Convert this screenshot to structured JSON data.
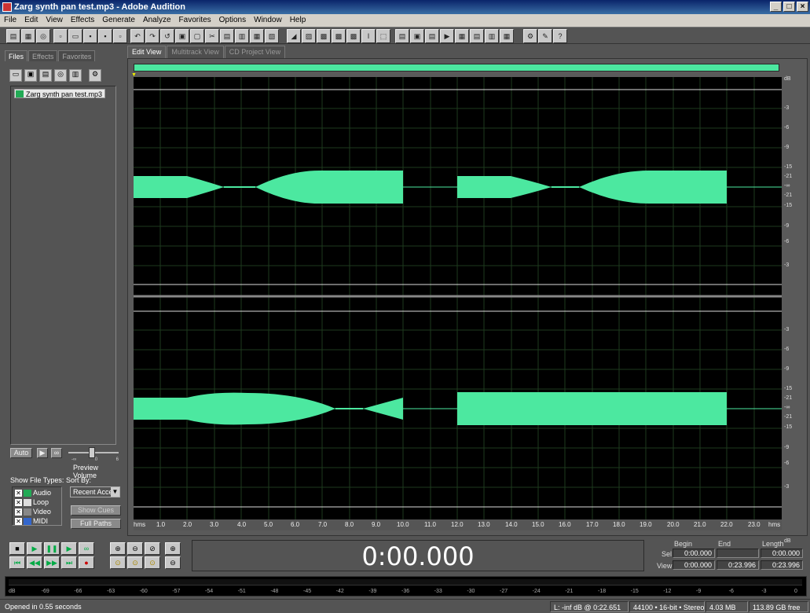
{
  "window": {
    "title": "Zarg synth pan test.mp3 - Adobe Audition",
    "buttons": [
      "_",
      "□",
      "×"
    ]
  },
  "menu": [
    "File",
    "Edit",
    "View",
    "Effects",
    "Generate",
    "Analyze",
    "Favorites",
    "Options",
    "Window",
    "Help"
  ],
  "left_panel": {
    "tabs": [
      "Files",
      "Effects",
      "Favorites"
    ],
    "active_tab": "Files",
    "files": [
      "Zarg synth pan test.mp3"
    ],
    "preview": {
      "auto_label": "Auto",
      "volume_label": "Preview Volume",
      "volume_ticks": [
        "-∞",
        "0",
        "6"
      ]
    },
    "show_file_types_label": "Show File Types:",
    "file_types": [
      {
        "label": "Audio",
        "checked": true
      },
      {
        "label": "Loop",
        "checked": true
      },
      {
        "label": "Video",
        "checked": true
      },
      {
        "label": "MIDI",
        "checked": true
      }
    ],
    "sort_by_label": "Sort By:",
    "sort_value": "Recent Acce",
    "show_cues_label": "Show Cues",
    "full_paths_label": "Full Paths"
  },
  "view_tabs": [
    "Edit View",
    "Multitrack View",
    "CD Project View"
  ],
  "active_view": "Edit View",
  "db_scale_top": [
    "dB",
    "-3",
    "-6",
    "-9",
    "-15",
    "-21",
    "-∞",
    "-21",
    "-15",
    "-9",
    "-6",
    "-3"
  ],
  "db_scale_bottom": [
    "-3",
    "-6",
    "-9",
    "-15",
    "-21",
    "-∞",
    "-21",
    "-15",
    "-9",
    "-6",
    "-3",
    "dB"
  ],
  "timeline": {
    "start_label": "hms",
    "end_label": "hms",
    "ticks": [
      "1.0",
      "2.0",
      "3.0",
      "4.0",
      "5.0",
      "6.0",
      "7.0",
      "8.0",
      "9.0",
      "10.0",
      "11.0",
      "12.0",
      "13.0",
      "14.0",
      "15.0",
      "16.0",
      "17.0",
      "18.0",
      "19.0",
      "20.0",
      "21.0",
      "22.0",
      "23.0"
    ]
  },
  "time_display": "0:00.000",
  "selection": {
    "headers": [
      "Begin",
      "End",
      "Length"
    ],
    "sel_label": "Sel",
    "view_label": "View",
    "sel": [
      "0:00.000",
      "",
      "0:00.000"
    ],
    "view": [
      "0:00.000",
      "0:23.996",
      "0:23.996"
    ]
  },
  "meter_scale": [
    "dB",
    "-69",
    "-66",
    "-63",
    "-60",
    "-57",
    "-54",
    "-51",
    "-48",
    "-45",
    "-42",
    "-39",
    "-36",
    "-33",
    "-30",
    "-27",
    "-24",
    "-21",
    "-18",
    "-15",
    "-12",
    "-9",
    "-6",
    "-3",
    "0"
  ],
  "status": {
    "message": "Opened in 0.55 seconds",
    "cursor": "L: -inf dB @  0:22.651",
    "format": "44100 • 16-bit • Stereo",
    "size": "4.03 MB",
    "free": "113.89 GB free"
  },
  "colors": {
    "waveform": "#4ce8a0",
    "background": "#000000",
    "panel": "#545454"
  }
}
